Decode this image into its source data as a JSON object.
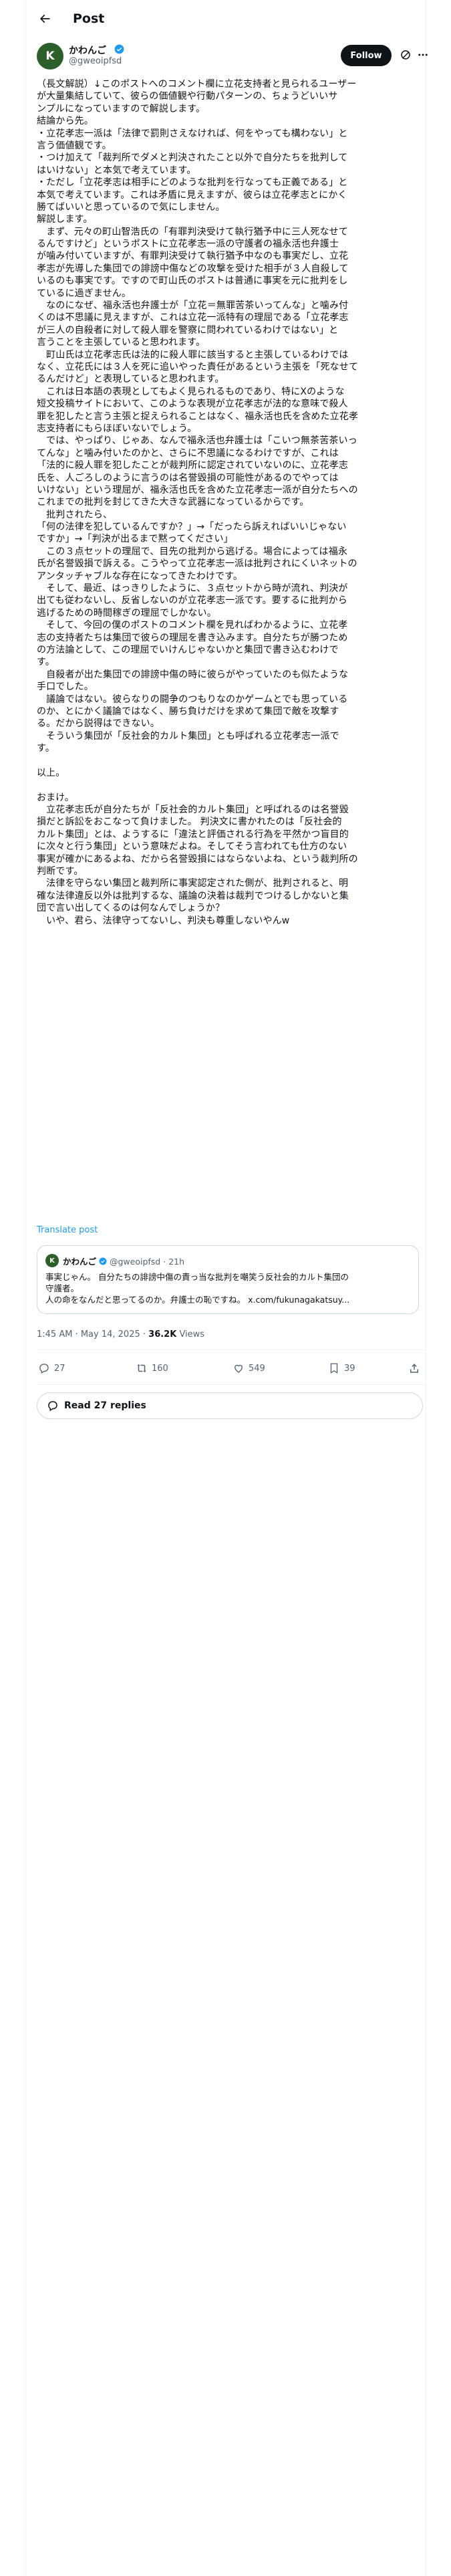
{
  "header": {
    "title": "Post"
  },
  "author": {
    "avatar_letter": "K",
    "name": "かわんご",
    "handle": "@gweoipfsd",
    "follow_label": "Follow"
  },
  "post": {
    "lines": [
      "（長文解説）↓このポストへのコメント欄に立花支持者と見られるユーザー",
      "が大量集結していて、彼らの価値観や行動パターンの、ちょうどいいサ",
      "ンプルになっていますので解説します。",
      "結論から先。",
      "・立花孝志一派は「法律で罰則さえなければ、何をやっても構わない」と",
      "言う価値観です。",
      "・つけ加えて「裁判所でダメと判決されたこと以外で自分たちを批判して",
      "はいけない」と本気で考えています。",
      "・ただし「立花孝志は相手にどのような批判を行なっても正義である」と",
      "本気で考えています。これは矛盾に見えますが、彼らは立花孝志とにかく",
      "勝てばいいと思っているので気にしません。",
      "解説します。",
      "　まず、元々の町山智浩氏の「有罪判決受けて執行猶予中に三人死なせて",
      "るんですけど」というポストに立花孝志一派の守護者の福永活也弁護士",
      "が噛み付いていますが、有罪判決受けて執行猶予中なのも事実だし、立花",
      "孝志が先導した集団での誹謗中傷などの攻撃を受けた相手が３人自殺して",
      "いるのも事実です。ですので町山氏のポストは普通に事実を元に批判をし",
      "ているに過ぎません。",
      "　なのになぜ、福永活也弁護士が「立花＝無罪苦茶いってんな」と噛み付",
      "くのは不思議に見えますが、これは立花一派特有の理屈である「立花孝志",
      "が三人の自殺者に対して殺人罪を警察に問われているわけではない」と",
      "言うことを主張していると思われます。",
      "　町山氏は立花孝志氏は法的に殺人罪に該当すると主張しているわけでは",
      "なく、立花氏には３人を死に追いやった責任があるという主張を「死なせて",
      "るんだけど」と表現していると思われます。",
      "　これは日本語の表現としてもよく見られるものであり、特にXのような",
      "短文投稿サイトにおいて、このような表現が立花孝志が法的な意味で殺人",
      "罪を犯したと言う主張と捉えられることはなく、福永活也氏を含めた立花孝",
      "志支持者にもらほぼいないでしょう。",
      "　では、やっぱり、じゃあ、なんで福永活也弁護士は「こいつ無茶苦茶いっ",
      "てんな」と噛み付いたのかと、さらに不思議になるわけですが、これは",
      "「法的に殺人罪を犯したことが裁判所に認定されていないのに、立花孝志",
      "氏を、人ごろしのように言うのは名誉毀損の可能性があるのでやっては",
      "いけない」という理屈が、福永活也氏を含めた立花孝志一派が自分たちへの",
      "これまでの批判を封じてきた大きな武器になっているからです。",
      "　批判されたら、",
      "「何の法律を犯しているんですか？」→「だったら訴えればいいじゃない",
      "ですか」→「判決が出るまで黙ってください」",
      "　この３点セットの理屈で、目先の批判から逃げる。場合によっては福永",
      "氏が名誉毀損で訴える。こうやって立花孝志一派は批判されにくいネットの",
      "アンタッチャブルな存在になってきたわけです。",
      "　そして、最近、はっきりしたように、３点セットから時が流れ、判決が",
      "出ても従わないし、反省しないのが立花孝志一派です。要するに批判から",
      "逃げるための時間稼ぎの理屈でしかない。",
      "　そして、今回の僕のポストのコメント欄を見ればわかるように、立花孝",
      "志の支持者たちは集団で彼らの理屈を書き込みます。自分たちが勝つため",
      "の方法論として、この理屈でいけんじゃないかと集団で書き込むわけで",
      "す。",
      "　自殺者が出た集団での誹謗中傷の時に彼らがやっていたのも似たような",
      "手口でした。",
      "　議論ではない。彼らなりの闘争のつもりなのかゲームとでも思っている",
      "のか、とにかく議論ではなく、勝ち負けだけを求めて集団で敵を攻撃す",
      "る。だから説得はできない。",
      "　そういう集団が「反社会的カルト集団」とも呼ばれる立花孝志一派で",
      "す。",
      "",
      "以上。",
      "",
      "おまけ。",
      "　立花孝志氏が自分たちが「反社会的カルト集団」と呼ばれるのは名誉毀",
      "損だと訴訟をおこなって負けました。 判決文に書かれたのは「反社会的",
      "カルト集団」とは、ようするに「違法と評価される行為を平然かつ盲目的",
      "に次々と行う集団」という意味だよね。そしてそう言われても仕方のない",
      "事実が確かにあるよね、だから名誉毀損にはならないよね、という裁判所の",
      "判断です。",
      "　法律を守らない集団と裁判所に事実認定された側が、批判されると、明",
      "確な法律違反以外は批判するな、議論の決着は裁判でつけるしかないと集",
      "団で言い出してくるのは何なんでしょうか？",
      "　いや、君ら、法律守ってないし、判決も尊重しないやんw"
    ],
    "translate_label": "Translate post"
  },
  "quote": {
    "avatar_letter": "K",
    "name": "かわんご",
    "handle": "@gweoipfsd",
    "time": "21h",
    "lines": [
      "事実じゃん。 自分たちの誹謗中傷の責っ当な批判を嘲笑う反社会的カルト集団の",
      "守護者。",
      "人の命をなんだと思ってるのか。弁護士の恥ですね。 x.com/fukunagakatsuy..."
    ]
  },
  "meta": {
    "time": "1:45 AM",
    "date": "May 14, 2025",
    "views_count": "36.2K",
    "views_label": "Views"
  },
  "actions": {
    "replies": "27",
    "reposts": "160",
    "likes": "549",
    "bookmarks": "39"
  },
  "read_replies_label": "Read 27 replies",
  "colors": {
    "accent": "#1d9bf0",
    "text": "#0f1419",
    "muted": "#536471",
    "border": "#cfd9de"
  }
}
